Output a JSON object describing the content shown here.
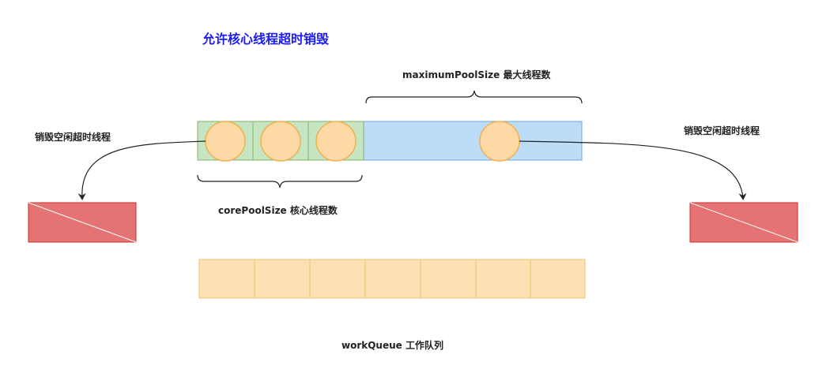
{
  "title": "允许核心线程超时销毁",
  "labels": {
    "maximum_pool": "maximumPoolSize 最大线程数",
    "core_pool": "corePoolSize 核心线程数",
    "destroy_left": "销毁空闲超时线程",
    "destroy_right": "销毁空闲超时线程",
    "work_queue": "workQueue 工作队列"
  },
  "colors": {
    "title": "#1a1aff",
    "core_cell_fill": "#c6e6c3",
    "core_cell_stroke": "#82b366",
    "max_area_fill": "#bcdcf7",
    "max_area_stroke": "#6ea6d8",
    "thread_fill": "#fdd9a6",
    "thread_stroke": "#f0b14f",
    "destroyed_fill": "#e57373",
    "destroyed_stroke": "#c9302c",
    "queue_fill": "#fde0b3",
    "queue_stroke": "#f0c070"
  },
  "counts": {
    "core_threads": 3,
    "extra_threads": 1,
    "queue_slots": 7
  }
}
